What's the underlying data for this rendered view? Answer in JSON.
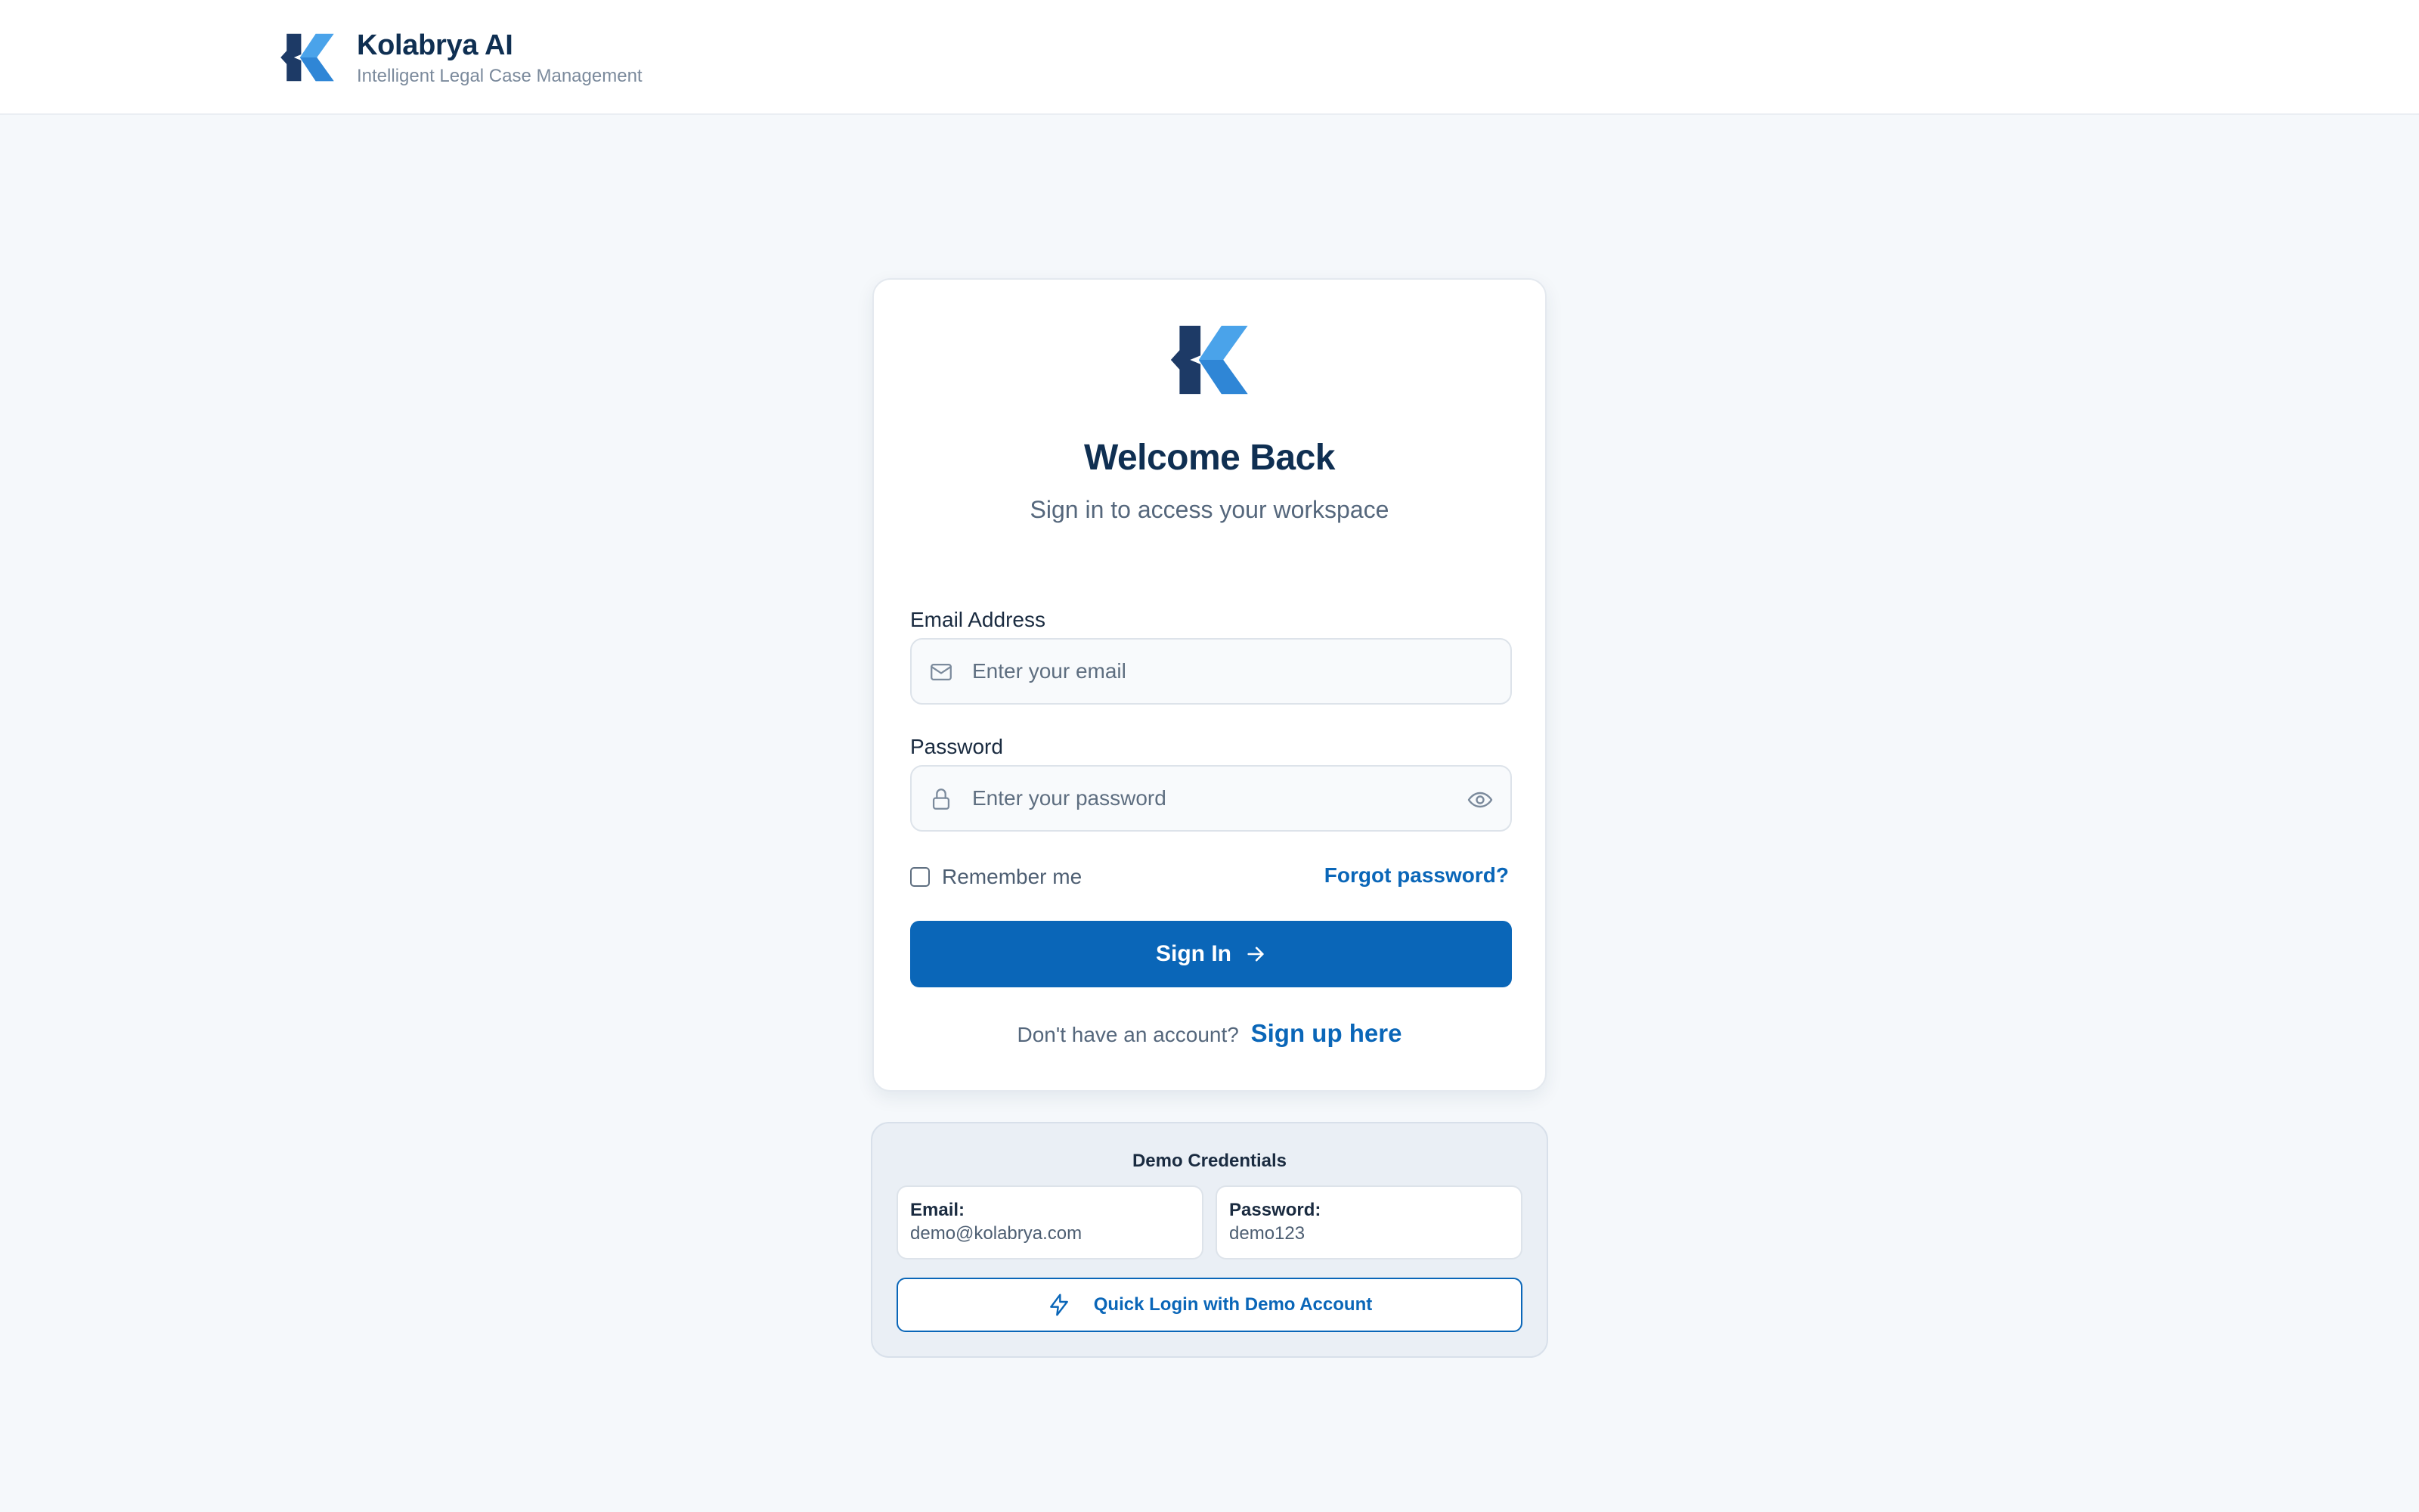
{
  "brand": {
    "name": "Kolabrya AI",
    "tagline": "Intelligent Legal Case Management",
    "logo_icon": "kolabrya-k-logo-icon",
    "colors": {
      "dark": "#1d3a66",
      "light": "#4aa3ea"
    }
  },
  "login": {
    "title": "Welcome Back",
    "subtitle": "Sign in to access your workspace",
    "email": {
      "label": "Email Address",
      "placeholder": "Enter your email",
      "value": "",
      "icon": "mail-icon"
    },
    "password": {
      "label": "Password",
      "placeholder": "Enter your password",
      "value": "",
      "icon": "lock-icon",
      "toggle_icon": "eye-icon"
    },
    "remember_label": "Remember me",
    "remember_checked": false,
    "forgot_label": "Forgot password?",
    "submit_label": "Sign In",
    "submit_icon": "arrow-right-icon",
    "signup_prompt": "Don't have an account?",
    "signup_link": "Sign up here"
  },
  "demo": {
    "title": "Demo Credentials",
    "email_key": "Email:",
    "email_value": "demo@kolabrya.com",
    "password_key": "Password:",
    "password_value": "demo123",
    "quick_login_label": "Quick Login with Demo Account",
    "quick_login_icon": "lightning-bolt-icon"
  },
  "colors": {
    "accent": "#0a66b8",
    "heading": "#0f2f52",
    "background": "#f5f8fb"
  }
}
